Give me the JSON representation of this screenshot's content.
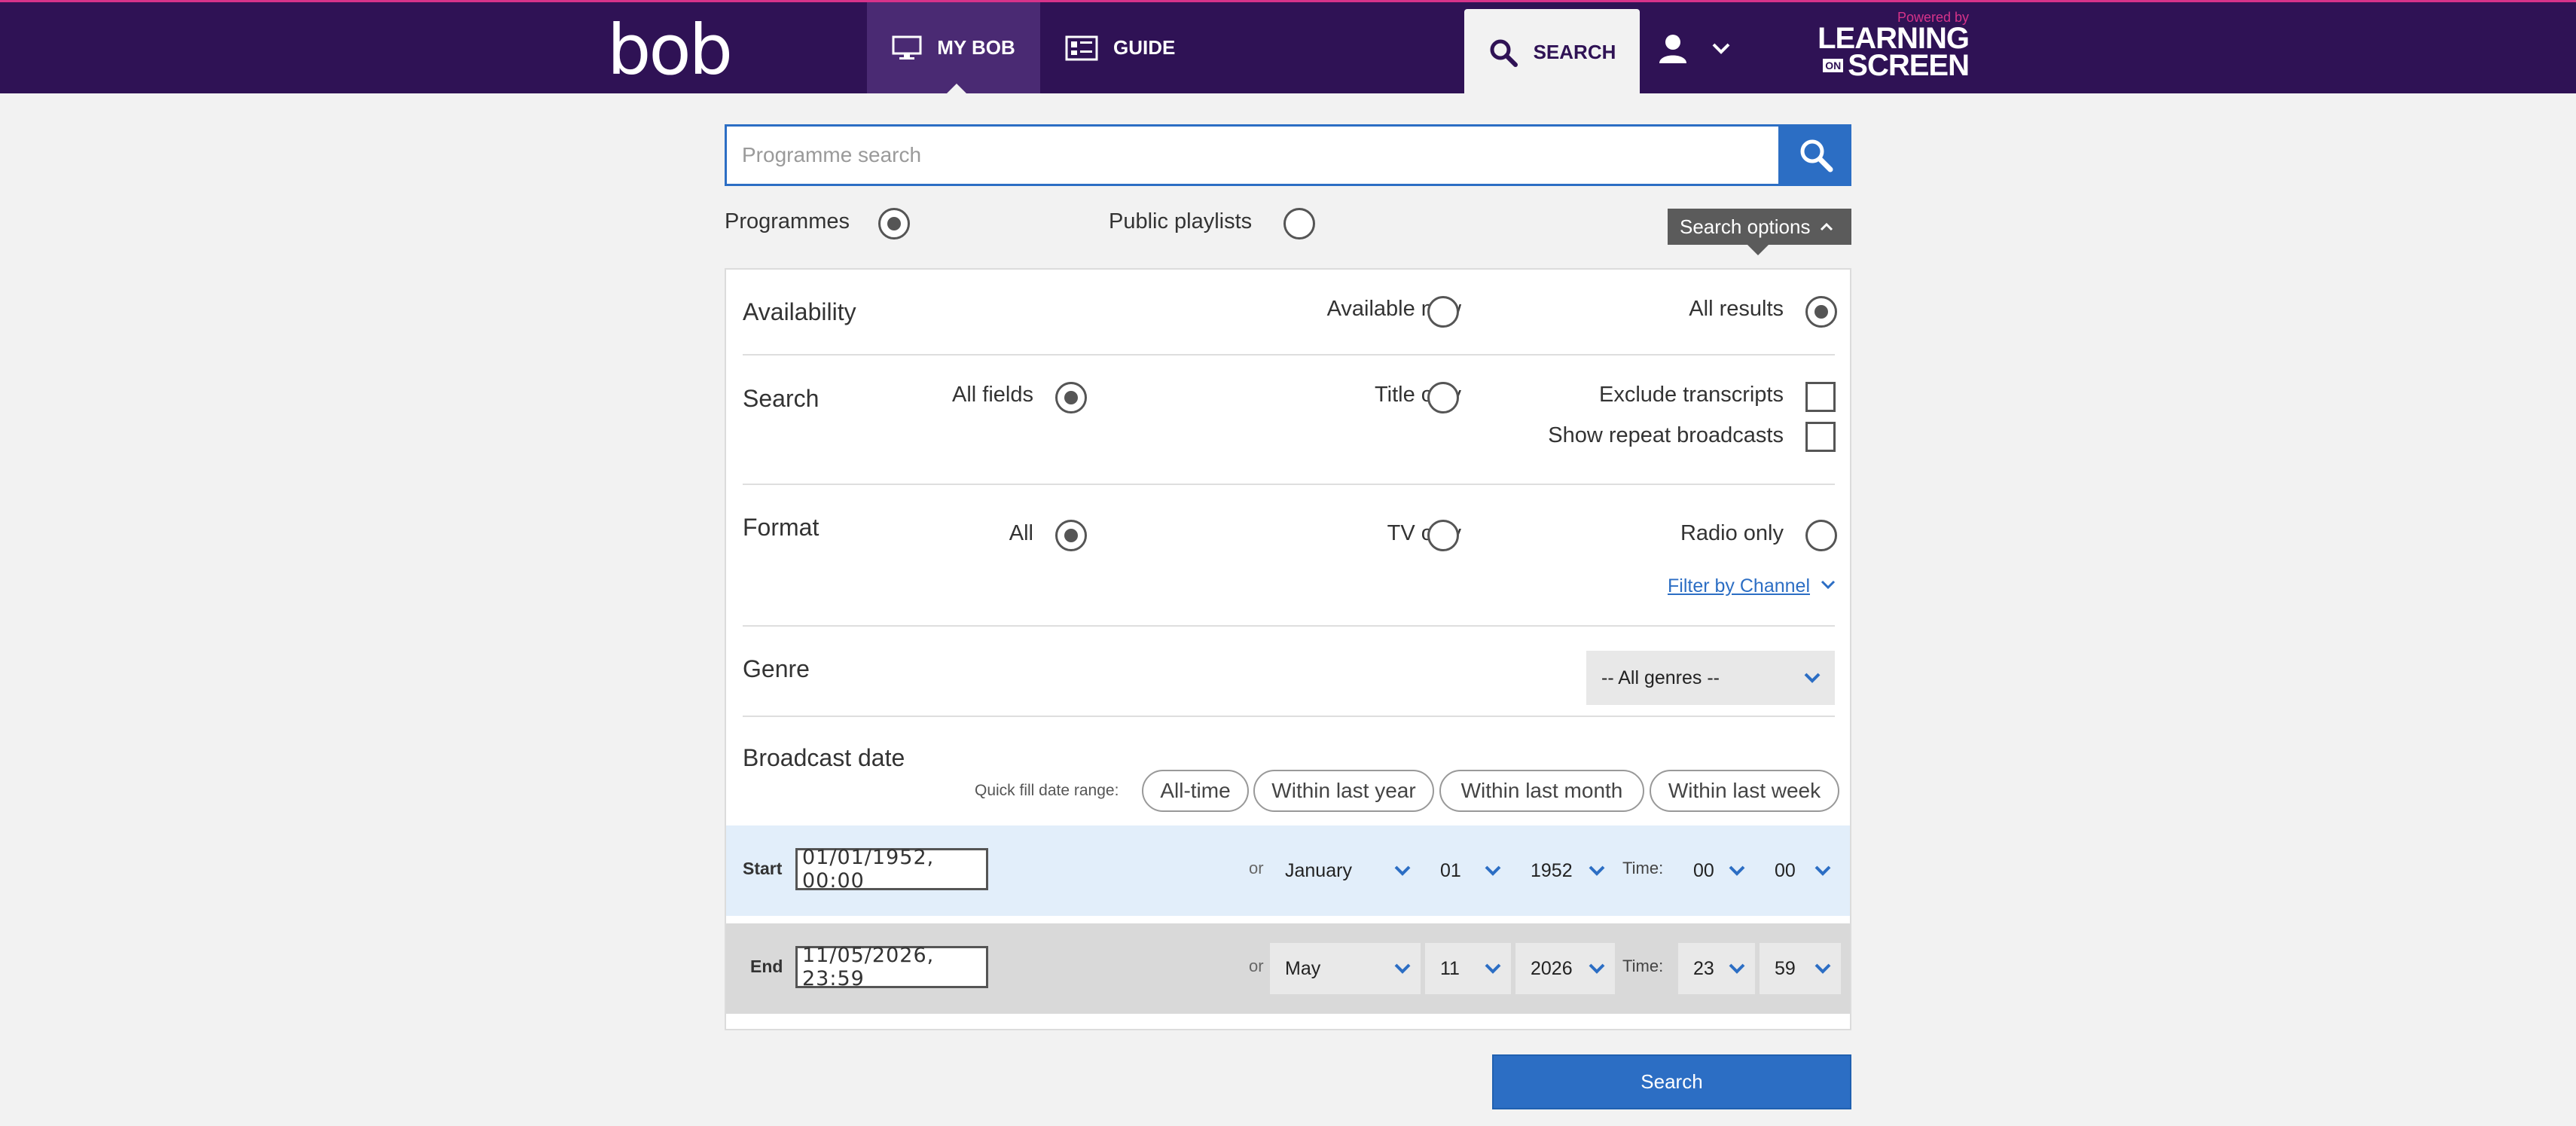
{
  "header": {
    "logo": "bob",
    "nav": {
      "my_bob": "MY BOB",
      "guide": "GUIDE",
      "search": "SEARCH"
    },
    "brand": {
      "powered_by": "Powered by",
      "learning": "LEARNING",
      "on": "ON",
      "screen": "SCREEN"
    }
  },
  "search": {
    "placeholder": "Programme search",
    "value": ""
  },
  "type_toggle": {
    "programmes": "Programmes",
    "public_playlists": "Public playlists",
    "selected": "programmes"
  },
  "search_options_label": "Search options",
  "availability": {
    "title": "Availability",
    "available_now": "Available now",
    "all_results": "All results",
    "selected": "all_results"
  },
  "search_fields": {
    "title": "Search",
    "all_fields": "All fields",
    "title_only": "Title only",
    "exclude_transcripts": "Exclude transcripts",
    "show_repeat_broadcasts": "Show repeat broadcasts",
    "selected": "all_fields",
    "exclude_transcripts_checked": false,
    "show_repeat_broadcasts_checked": false
  },
  "format": {
    "title": "Format",
    "all": "All",
    "tv_only": "TV only",
    "radio_only": "Radio only",
    "selected": "all",
    "filter_by_channel": "Filter by Channel"
  },
  "genre": {
    "title": "Genre",
    "selected": "-- All genres --"
  },
  "broadcast_date": {
    "title": "Broadcast date",
    "quick_fill_label": "Quick fill date range:",
    "quick_fill": [
      "All-time",
      "Within last year",
      "Within last month",
      "Within last week"
    ],
    "start": {
      "label": "Start",
      "datetime": "01/01/1952, 00:00",
      "or": "or",
      "month": "January",
      "day": "01",
      "year": "1952",
      "time_label": "Time:",
      "hour": "00",
      "minute": "00"
    },
    "end": {
      "label": "End",
      "datetime": "11/05/2026, 23:59",
      "or": "or",
      "month": "May",
      "day": "11",
      "year": "2026",
      "time_label": "Time:",
      "hour": "23",
      "minute": "59"
    }
  },
  "submit_label": "Search",
  "colors": {
    "header_bg": "#2f1255",
    "accent_blue": "#2c6ec4",
    "brand_pink": "#d6338a"
  }
}
